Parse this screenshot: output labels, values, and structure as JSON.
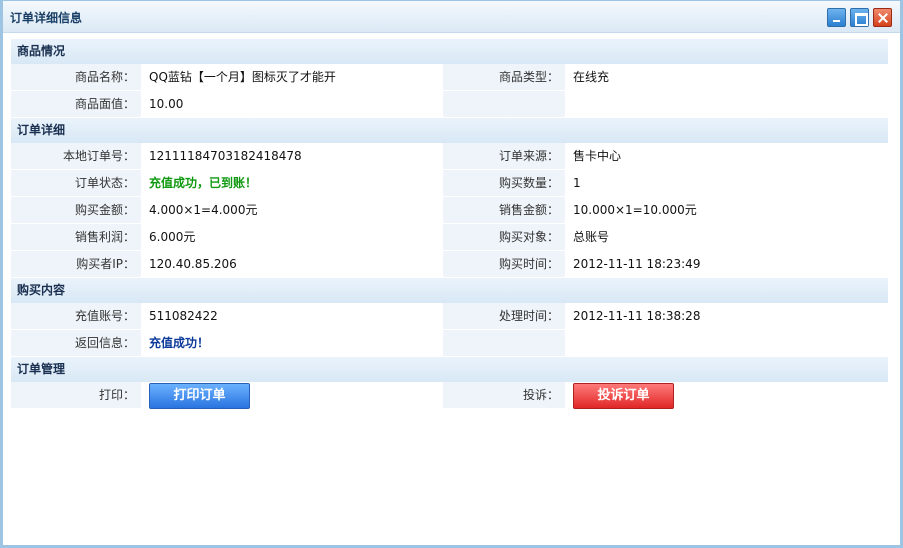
{
  "window": {
    "title": "订单详细信息"
  },
  "sections": {
    "product": {
      "header": "商品情况",
      "rows": [
        {
          "l1": "商品名称：",
          "v1": "QQ蓝钻【一个月】图标灭了才能开",
          "l2": "商品类型：",
          "v2": "在线充"
        },
        {
          "l1": "商品面值：",
          "v1": "10.00",
          "l2": "",
          "v2": ""
        }
      ]
    },
    "order": {
      "header": "订单详细",
      "rows": [
        {
          "l1": "本地订单号：",
          "v1": "12111184703182418478",
          "l2": "订单来源：",
          "v2": "售卡中心"
        },
        {
          "l1": "订单状态：",
          "v1": "充值成功，已到账！",
          "l2": "购买数量：",
          "v2": "1"
        },
        {
          "l1": "购买金额：",
          "v1": "4.000×1=4.000元",
          "l2": "销售金额：",
          "v2": "10.000×1=10.000元"
        },
        {
          "l1": "销售利润：",
          "v1": "6.000元",
          "l2": "购买对象：",
          "v2": "总账号"
        },
        {
          "l1": "购买者IP：",
          "v1": "120.40.85.206",
          "l2": "购买时间：",
          "v2": "2012-11-11 18:23:49"
        }
      ]
    },
    "content": {
      "header": "购买内容",
      "rows": [
        {
          "l1": "充值账号：",
          "v1": "511082422",
          "l2": "处理时间：",
          "v2": "2012-11-11 18:38:28"
        },
        {
          "l1": "返回信息：",
          "v1": "充值成功！",
          "l2": "",
          "v2": ""
        }
      ]
    },
    "manage": {
      "header": "订单管理",
      "print_label": "打印：",
      "print_button": "打印订单",
      "complain_label": "投诉：",
      "complain_button": "投诉订单"
    }
  },
  "colors": {
    "status_success": "#119a11",
    "return_info": "#0c3a9a",
    "print_button": "#2a74e0",
    "complain_button": "#e02727"
  }
}
